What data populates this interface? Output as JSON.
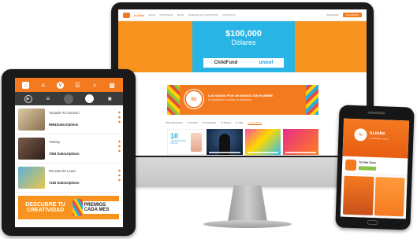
{
  "desktop": {
    "nav": {
      "brand": "tu.tube",
      "items": [
        "INICIO",
        "NOSOTROS",
        "BLOG",
        "TRABAJA CON NOSOTROS",
        "CONTACTO"
      ],
      "login": "INGRESAR",
      "cta": "SUSCRIBIR"
    },
    "hero": {
      "amount": "$100,000",
      "currency": "Dólares",
      "partner_1": "ChildFund",
      "partner_2": "unicef"
    },
    "campaign": {
      "logo_text": "tu",
      "headline": "LUCHANDO POR UN MUNDO SIN HAMBRE",
      "subline": "TU CONTENIDO, TU CAUSA, TU FUNDACIÓN"
    },
    "categories": [
      "Videos Recientes",
      "Tu Familia",
      "Tu Inspiración",
      "Tu Música",
      "Tu Vida",
      "Videos Virales"
    ],
    "feature_card": {
      "number": "10",
      "text": "USUARIOS MÁS VISTOS"
    }
  },
  "tablet": {
    "channels": [
      {
        "name": "Tocando Tu Corazon",
        "subs": "9694Subscriptions"
      },
      {
        "name": "Yamary",
        "subs": "7063 Subscriptions"
      },
      {
        "name": "Recetas De Laura",
        "subs": "7225 Subscriptions"
      }
    ],
    "promo": {
      "left": "DESCUBRE TU CREATIVIDAD",
      "right": "PREMIOS CADA MES"
    }
  },
  "phone": {
    "brand": "tu.tube",
    "tagline": "tu contenido, tu causa",
    "app_title": "Tu Dale Gana"
  }
}
